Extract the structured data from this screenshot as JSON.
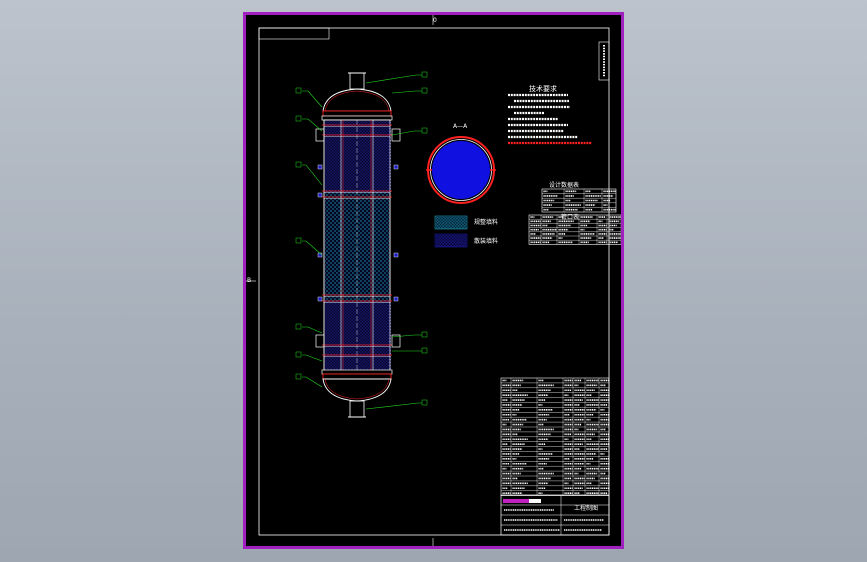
{
  "colors": {
    "canvas_top": "#bcc3cc",
    "canvas_bottom": "#9ea6b2",
    "sheet_background": "#000000",
    "sheet_border": "#a020c0",
    "line_white": "#ffffff",
    "outline_red": "#ff2020",
    "packing_blue": "#2020c0",
    "packing_cyan": "#20c0e0",
    "leader_green": "#20e020",
    "section_fill": "#1010e0"
  },
  "markers": {
    "border_center": "0",
    "left_edge": "B"
  },
  "drawing": {
    "section_label": "A—A",
    "legend": {
      "packing_a": "规整填料",
      "packing_b": "散装填料"
    },
    "tech_requirements_title": "技术要求",
    "nozzle_table_title": "管口表",
    "design_table_title": "设计数据表",
    "title_block": {
      "drawing_name": "工程制图"
    }
  }
}
